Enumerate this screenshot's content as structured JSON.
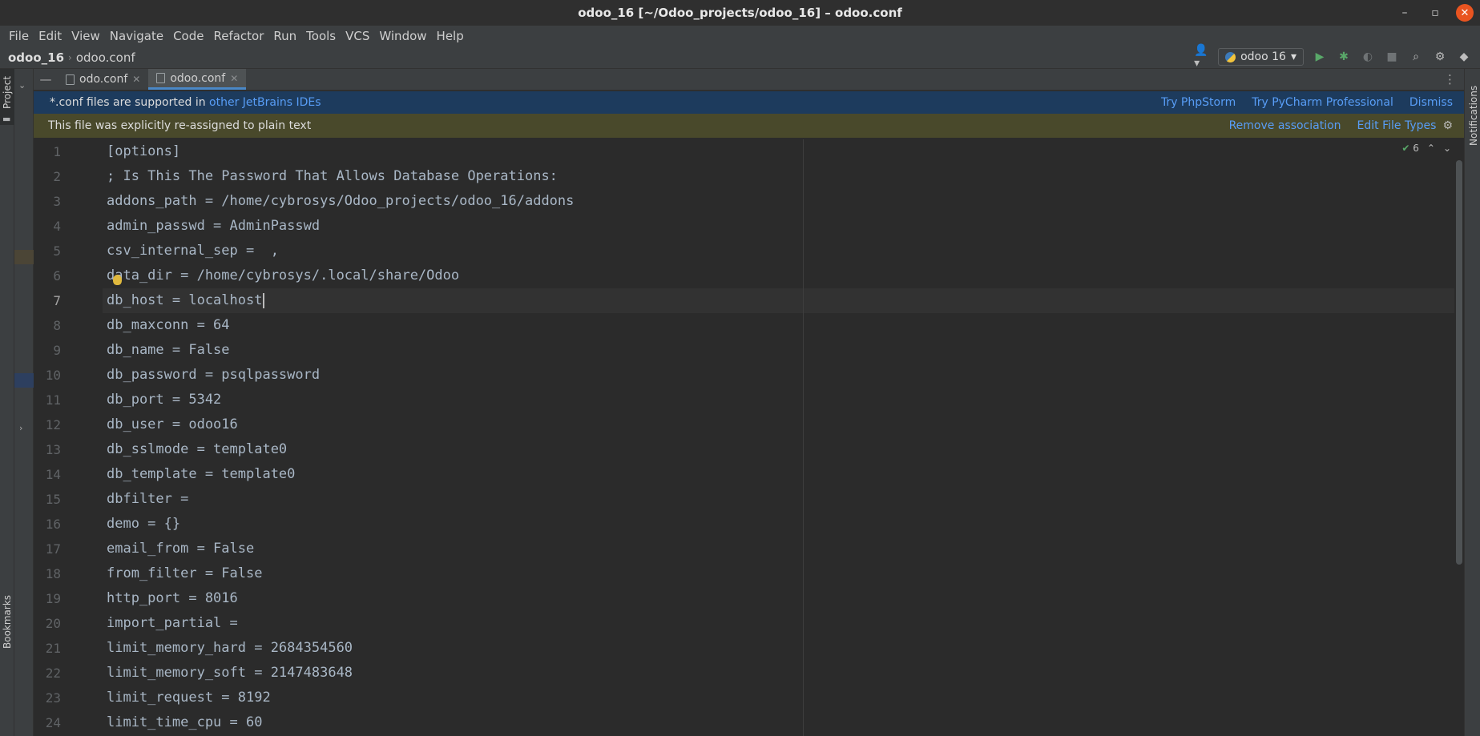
{
  "window": {
    "title": "odoo_16 [~/Odoo_projects/odoo_16] – odoo.conf"
  },
  "menu": [
    "File",
    "Edit",
    "View",
    "Navigate",
    "Code",
    "Refactor",
    "Run",
    "Tools",
    "VCS",
    "Window",
    "Help"
  ],
  "breadcrumb": {
    "project": "odoo_16",
    "file": "odoo.conf"
  },
  "toolbar": {
    "run_config": "odoo 16"
  },
  "side_tabs": {
    "project": "Project",
    "bookmarks": "Bookmarks",
    "notifications": "Notifications"
  },
  "tabs": [
    {
      "label": "odo.conf",
      "active": false
    },
    {
      "label": "odoo.conf",
      "active": true
    }
  ],
  "banner_plugin": {
    "text": "*.conf files are supported in",
    "link": "other JetBrains IDEs",
    "actions": [
      "Try PhpStorm",
      "Try PyCharm Professional",
      "Dismiss"
    ]
  },
  "banner_filetype": {
    "text": "This file was explicitly re-assigned to plain text",
    "actions": [
      "Remove association",
      "Edit File Types"
    ]
  },
  "editor": {
    "inspection_count": "6",
    "current_line": 7,
    "lines": [
      "[options]",
      "; Is This The Password That Allows Database Operations:",
      "addons_path = /home/cybrosys/Odoo_projects/odoo_16/addons",
      "admin_passwd = AdminPasswd",
      "csv_internal_sep =  ,",
      "data_dir = /home/cybrosys/.local/share/Odoo",
      "db_host = localhost",
      "db_maxconn = 64",
      "db_name = False",
      "db_password = psqlpassword",
      "db_port = 5342",
      "db_user = odoo16",
      "db_sslmode = template0",
      "db_template = template0",
      "dbfilter =",
      "demo = {}",
      "email_from = False",
      "from_filter = False",
      "http_port = 8016",
      "import_partial =",
      "limit_memory_hard = 2684354560",
      "limit_memory_soft = 2147483648",
      "limit_request = 8192",
      "limit_time_cpu = 60"
    ]
  },
  "colors": {
    "editor_bg": "#2b2b2b",
    "code_text": "#a9b7c6",
    "banner_blue": "#1d3b5d",
    "banner_olive": "#49492b",
    "link": "#589df6"
  }
}
